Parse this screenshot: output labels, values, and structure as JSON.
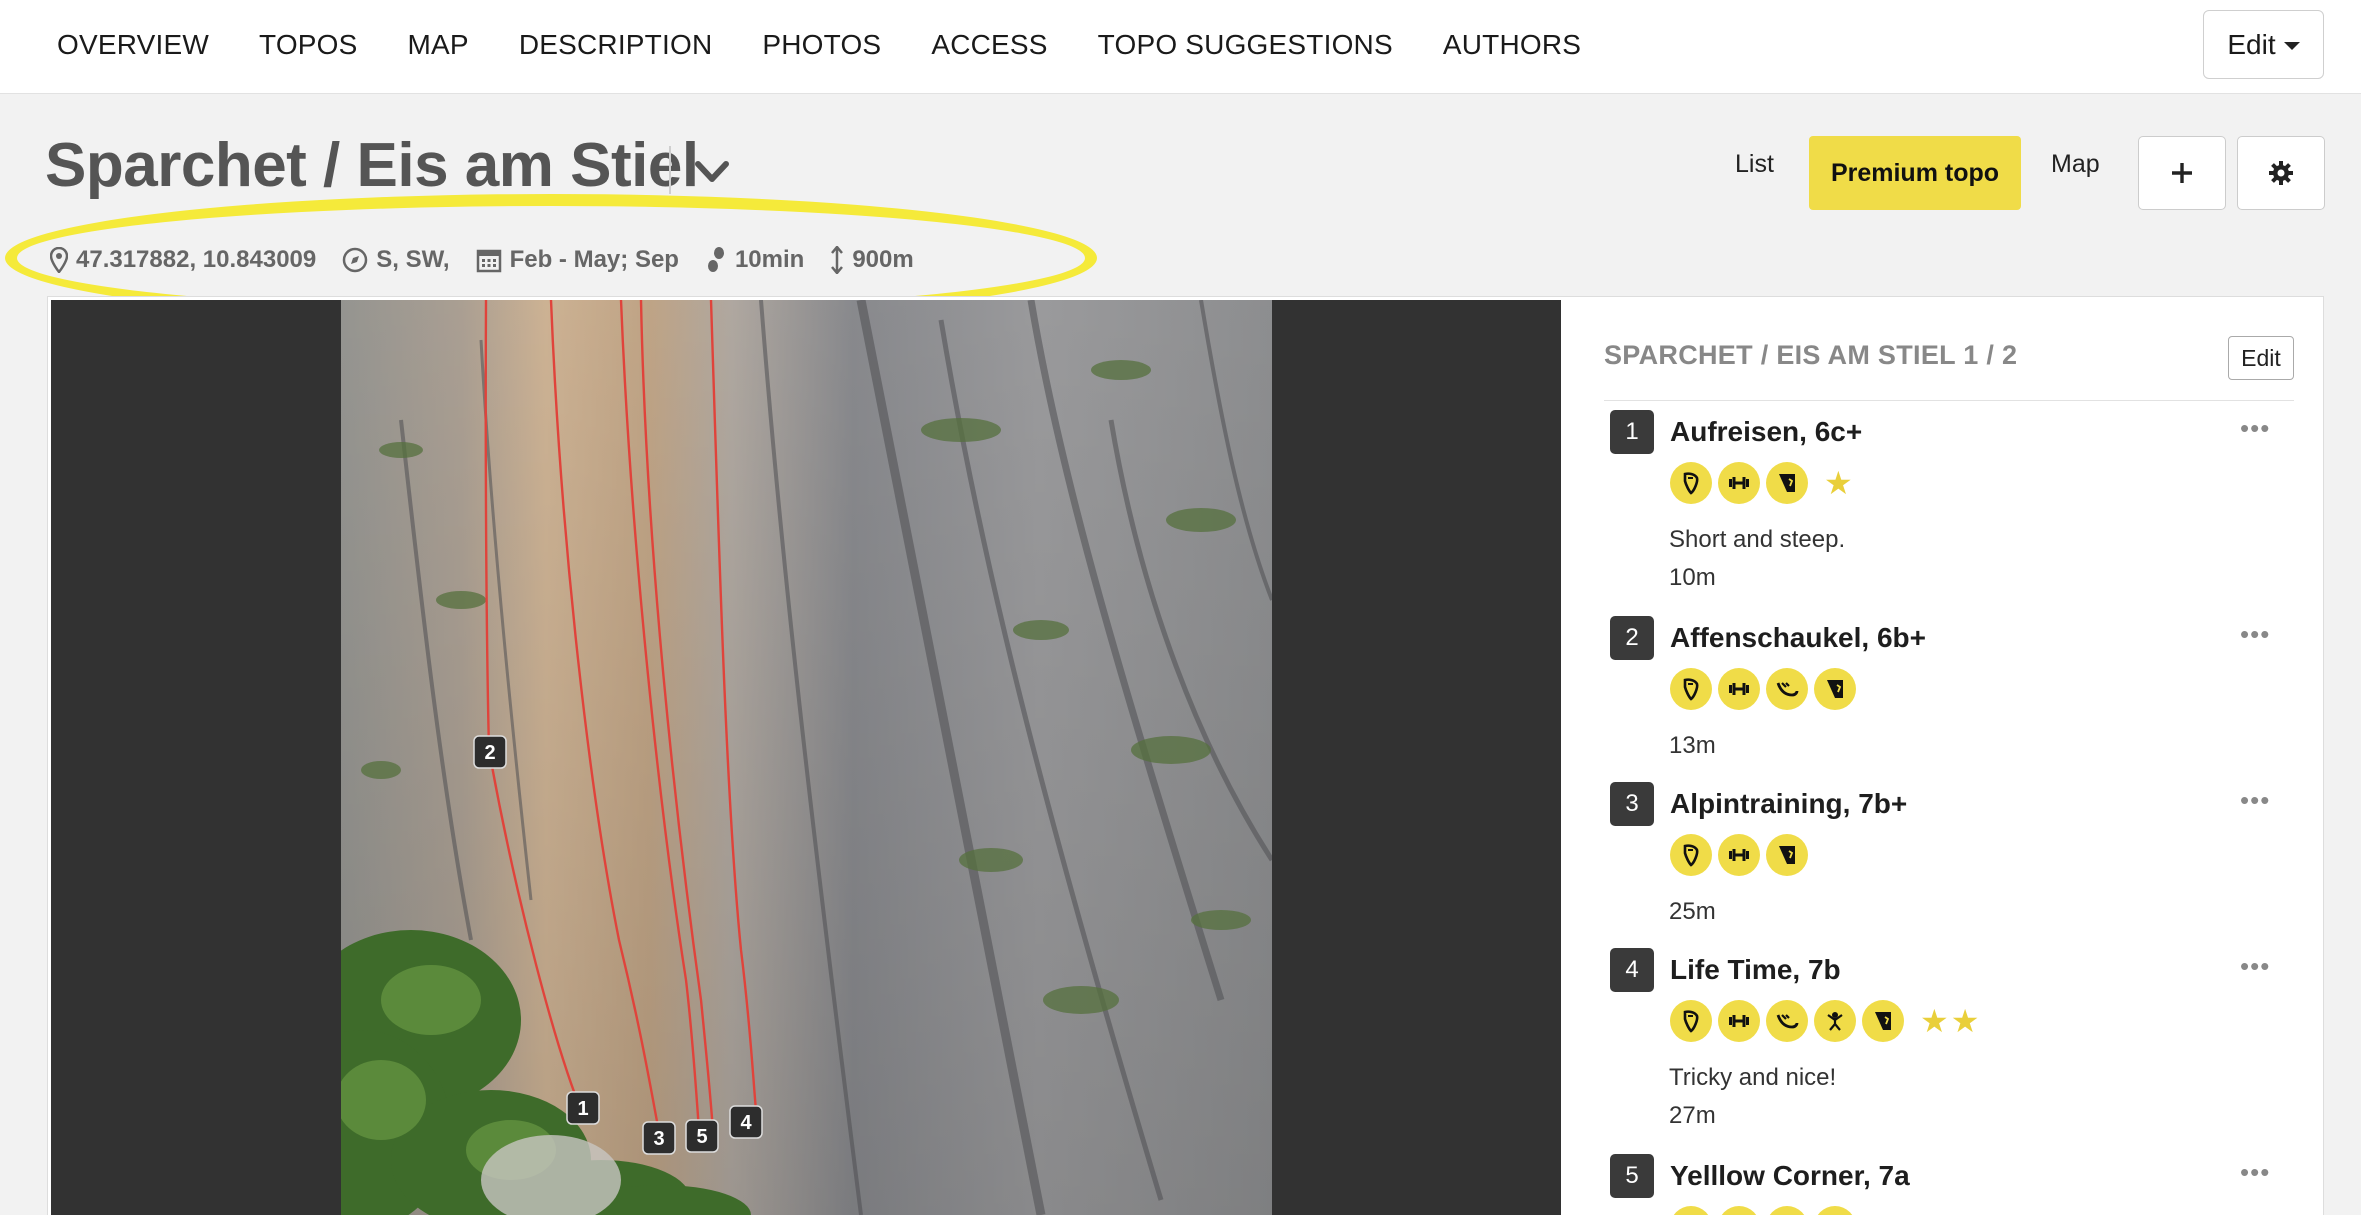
{
  "nav": {
    "links": [
      "OVERVIEW",
      "TOPOS",
      "MAP",
      "DESCRIPTION",
      "PHOTOS",
      "ACCESS",
      "TOPO SUGGESTIONS",
      "AUTHORS"
    ],
    "edit_label": "Edit"
  },
  "header": {
    "title": "Sparchet / Eis am Stiel",
    "view_list": "List",
    "view_premium": "Premium topo",
    "view_map": "Map"
  },
  "meta": {
    "coords": "47.317882, 10.843009",
    "aspect": "S, SW,",
    "season": "Feb - May; Sep",
    "approach": "10min",
    "altitude": "900m"
  },
  "topo": {
    "title": "SPARCHET / EIS AM STIEL 1 / 2",
    "edit_label": "Edit",
    "markers": [
      "2",
      "1",
      "3",
      "5",
      "4"
    ]
  },
  "routes": [
    {
      "num": "1",
      "name": "Aufreisen, 6c+",
      "tags": [
        "crimp-icon",
        "dumbbell-icon",
        "overhang-icon"
      ],
      "stars": "★",
      "desc": "Short and steep.",
      "length": "10m"
    },
    {
      "num": "2",
      "name": "Affenschaukel, 6b+",
      "tags": [
        "crimp-icon",
        "dumbbell-icon",
        "slope-icon",
        "overhang-icon"
      ],
      "stars": "",
      "desc": "",
      "length": "13m"
    },
    {
      "num": "3",
      "name": "Alpintraining, 7b+",
      "tags": [
        "crimp-icon",
        "dumbbell-icon",
        "overhang-icon"
      ],
      "stars": "",
      "desc": "",
      "length": "25m"
    },
    {
      "num": "4",
      "name": "Life Time, 7b",
      "tags": [
        "crimp-icon",
        "dumbbell-icon",
        "slope-icon",
        "dynamic-icon",
        "overhang-icon"
      ],
      "stars": "★★",
      "desc": "Tricky and nice!",
      "length": "27m"
    },
    {
      "num": "5",
      "name": "Yelllow Corner, 7a",
      "tags": [],
      "stars": "",
      "desc": "",
      "length": ""
    }
  ],
  "colors": {
    "accent_yellow": "#f0dc48",
    "highlight_yellow": "#f5ea3a",
    "route_line": "#e0433b",
    "badge_dark": "#3a3a3a"
  }
}
